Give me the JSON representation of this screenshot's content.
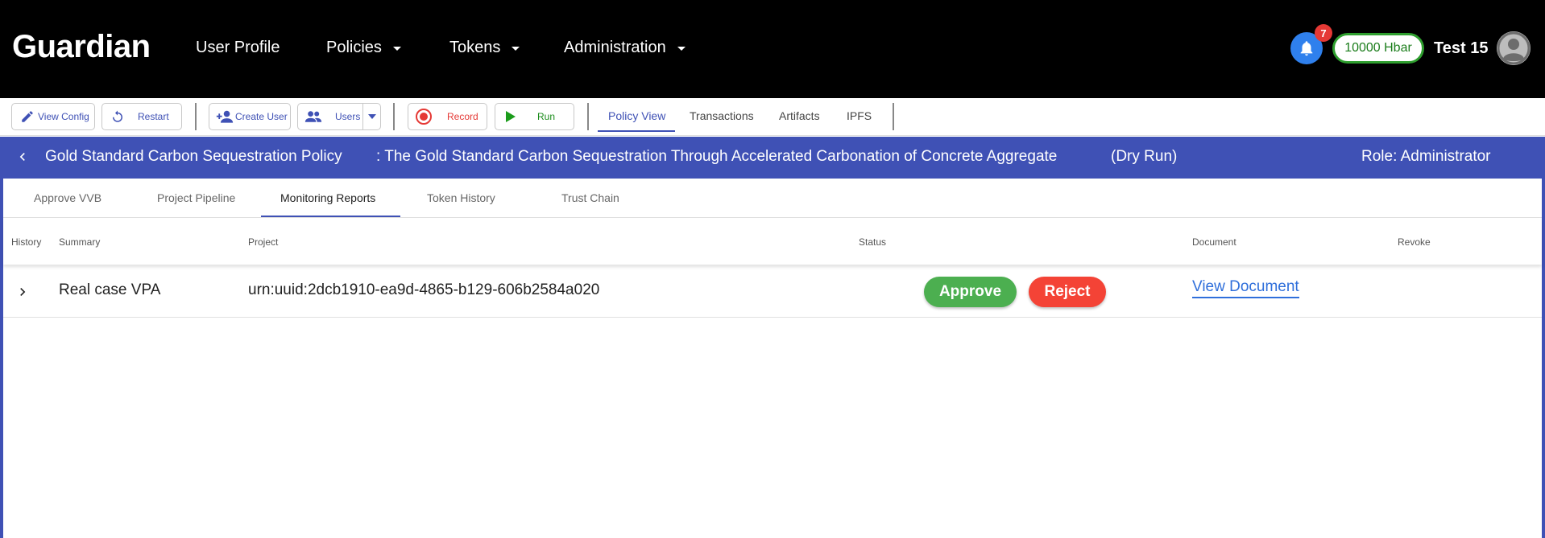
{
  "app": {
    "logo": "Guardian",
    "nav": [
      {
        "label": "User Profile"
      },
      {
        "label": "Policies"
      },
      {
        "label": "Tokens"
      },
      {
        "label": "Administration"
      }
    ],
    "notifications_count": "7",
    "balance": "10000 Hbar",
    "username": "Test 15"
  },
  "toolbar": {
    "view_config": "View Config",
    "restart": "Restart",
    "create_user": "Create User",
    "users": "Users",
    "record": "Record",
    "run": "Run",
    "tabs": [
      {
        "label": "Policy View",
        "active": true
      },
      {
        "label": "Transactions",
        "active": false
      },
      {
        "label": "Artifacts",
        "active": false
      },
      {
        "label": "IPFS",
        "active": false
      }
    ]
  },
  "policy": {
    "name": "Gold Standard Carbon Sequestration Policy",
    "description": ": The Gold Standard Carbon Sequestration Through Accelerated Carbonation of Concrete Aggregate",
    "mode": "(Dry Run)",
    "role": "Role: Administrator"
  },
  "tabs": [
    {
      "label": "Approve VVB",
      "active": false
    },
    {
      "label": "Project Pipeline",
      "active": false
    },
    {
      "label": "Monitoring Reports",
      "active": true
    },
    {
      "label": "Token History",
      "active": false
    },
    {
      "label": "Trust Chain",
      "active": false
    }
  ],
  "table": {
    "columns": [
      "History",
      "Summary",
      "Project",
      "Status",
      "Document",
      "Revoke"
    ],
    "rows": [
      {
        "summary": "Real case VPA",
        "project": "urn:uuid:2dcb1910-ea9d-4865-b129-606b2584a020",
        "approve_label": "Approve",
        "reject_label": "Reject",
        "document_link": "View Document"
      }
    ]
  },
  "colors": {
    "primary": "#3f51b5",
    "approve": "#4caf50",
    "reject": "#f44336",
    "balance_border": "#2e9e2e",
    "bell": "#2f80ed"
  }
}
